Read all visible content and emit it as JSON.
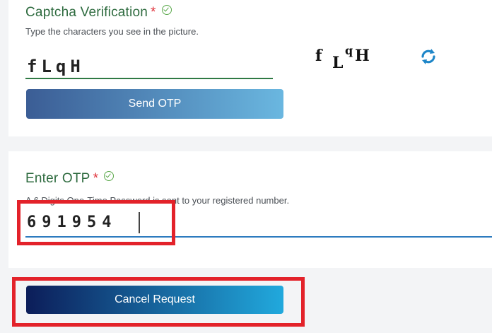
{
  "captcha": {
    "label": "Captcha Verification",
    "required_mark": "*",
    "hint": "Type the characters you see in the picture.",
    "input_value": "fLqH",
    "image_chars": [
      "f",
      "L",
      "q",
      "H"
    ],
    "refresh_icon": "refresh-icon"
  },
  "buttons": {
    "send_otp": "Send OTP",
    "cancel_request": "Cancel Request"
  },
  "otp": {
    "label": "Enter OTP",
    "required_mark": "*",
    "hint": "A 6 Digits One-Time Password is sent to your registered number.",
    "value": "691954"
  },
  "colors": {
    "label_green": "#2e6b3f",
    "required_red": "#e0323b",
    "highlight_red": "#e3222a",
    "otp_underline": "#2d7bbf"
  }
}
